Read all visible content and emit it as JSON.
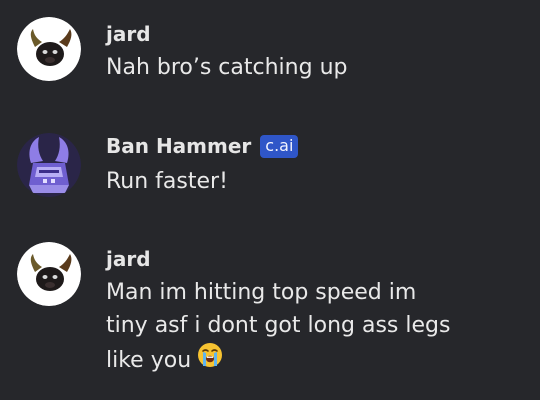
{
  "messages": [
    {
      "sender": "jard",
      "avatar_icon": "bull-skull-icon",
      "lines": [
        "Nah bro’s catching up"
      ]
    },
    {
      "sender": "Ban Hammer",
      "badge": "c.ai",
      "avatar_icon": "purple-horned-helmet-icon",
      "lines": [
        "Run faster!"
      ]
    },
    {
      "sender": "jard",
      "avatar_icon": "bull-skull-icon",
      "lines": [
        "Man im hitting top speed im",
        "tiny asf i dont got long ass legs",
        "like you"
      ],
      "trailing_emoji": "loudly-crying-face-icon"
    }
  ],
  "colors": {
    "background": "#26272b",
    "badge": "#2f56c8",
    "text": "#e9e9e9"
  }
}
